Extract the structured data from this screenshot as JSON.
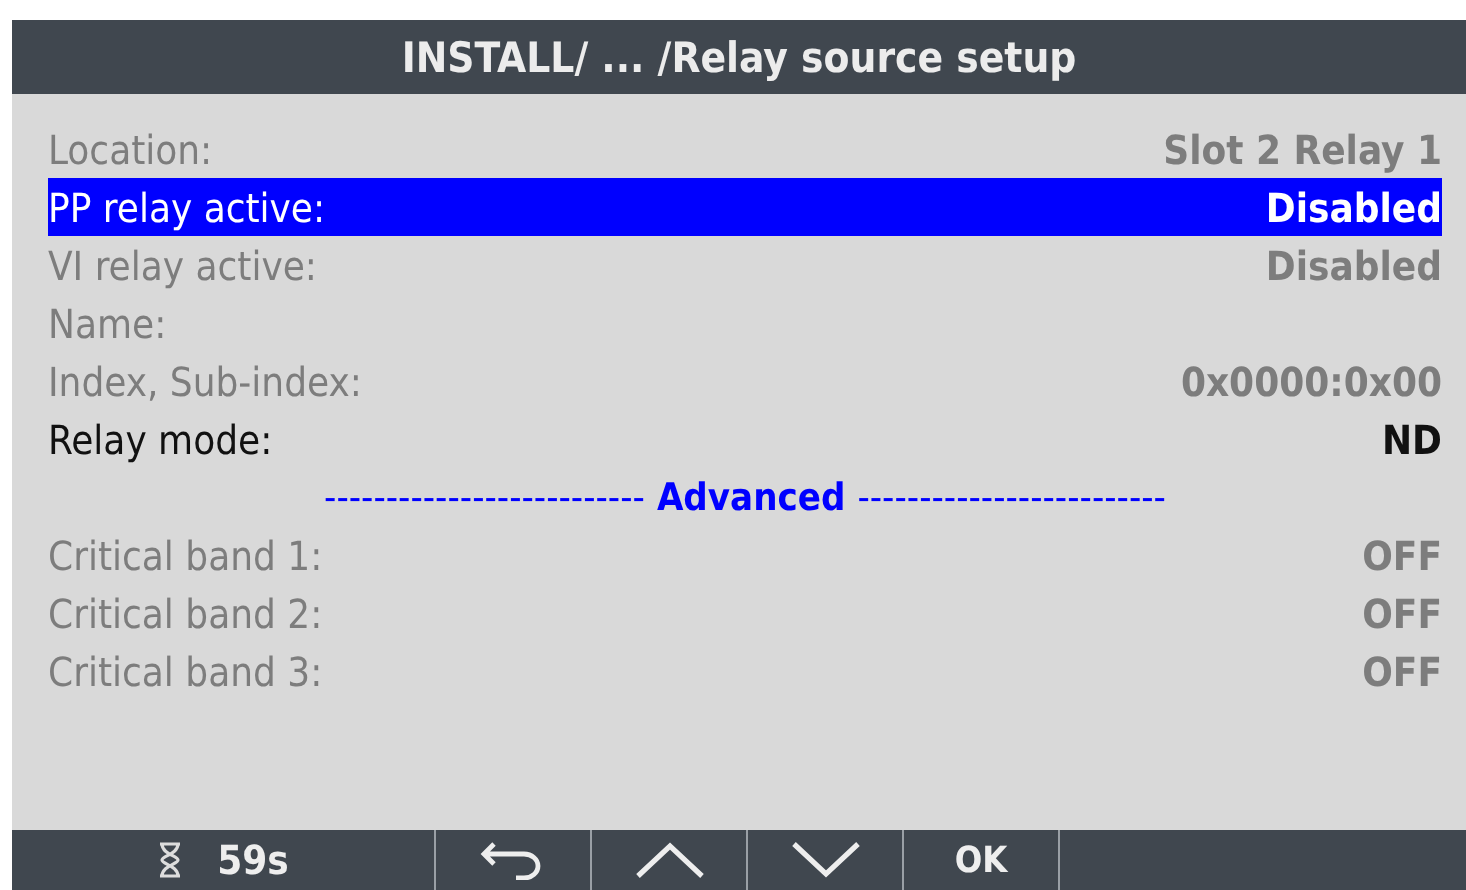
{
  "title": "INSTALL/ ... /Relay source setup",
  "rows": [
    {
      "kind": "field",
      "label": "Location:",
      "value": "Slot 2 Relay 1",
      "disabled": true,
      "selected": false
    },
    {
      "kind": "field",
      "label": "PP relay active:",
      "value": "Disabled",
      "disabled": false,
      "selected": true
    },
    {
      "kind": "field",
      "label": "VI relay active:",
      "value": "Disabled",
      "disabled": true,
      "selected": false
    },
    {
      "kind": "field",
      "label": "Name:",
      "disabled": true,
      "selected": false
    },
    {
      "kind": "field",
      "label": "Index, Sub-index:",
      "value": "0x0000:0x00",
      "disabled": true,
      "selected": false
    },
    {
      "kind": "field",
      "label": "Relay mode:",
      "value": "ND",
      "disabled": false,
      "selected": false
    },
    {
      "kind": "divider",
      "label": "Advanced",
      "left": "--------------------------",
      "right": "-------------------------"
    },
    {
      "kind": "field",
      "label": "Critical band 1:",
      "value": "OFF",
      "disabled": true,
      "selected": false
    },
    {
      "kind": "field",
      "label": "Critical band 2:",
      "value": "OFF",
      "disabled": true,
      "selected": false
    },
    {
      "kind": "field",
      "label": "Critical band 3:",
      "value": "OFF",
      "disabled": true,
      "selected": false
    }
  ],
  "footer": {
    "timer": "59s",
    "ok": "OK"
  }
}
